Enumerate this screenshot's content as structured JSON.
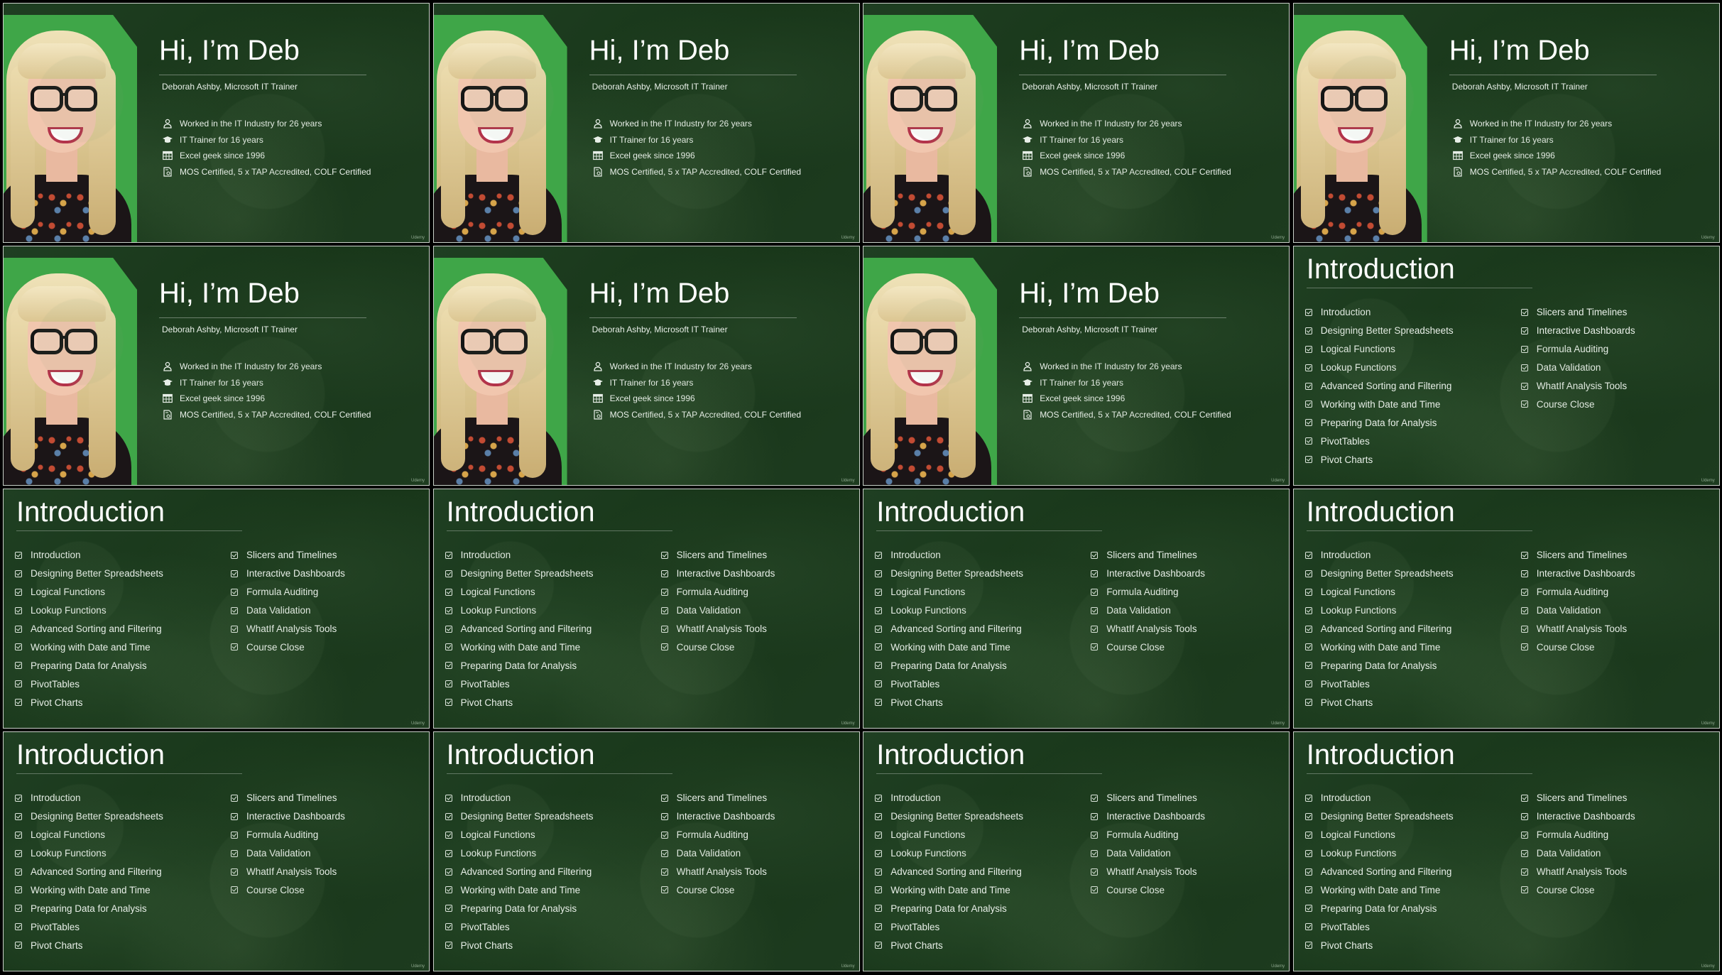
{
  "intro": {
    "title": "Hi, I’m Deb",
    "subtitle": "Deborah Ashby, Microsoft IT Trainer",
    "facts": [
      {
        "icon": "person-icon",
        "text": "Worked in the IT Industry for 26 years"
      },
      {
        "icon": "graduation-cap-icon",
        "text": "IT Trainer for 16 years"
      },
      {
        "icon": "spreadsheet-icon",
        "text": "Excel geek since 1996"
      },
      {
        "icon": "certificate-icon",
        "text": "MOS Certified, 5 x TAP Accredited, COLF Certified"
      }
    ],
    "brand": "Udemy",
    "accent": "#3fa648"
  },
  "agenda": {
    "title": "Introduction",
    "left": [
      "Introduction",
      "Designing Better Spreadsheets",
      "Logical Functions",
      "Lookup Functions",
      "Advanced Sorting and Filtering",
      "Working with Date and Time",
      "Preparing Data for Analysis",
      "PivotTables",
      "Pivot Charts"
    ],
    "right": [
      "Slicers and Timelines",
      "Interactive Dashboards",
      "Formula Auditing",
      "Data Validation",
      "WhatIf Analysis Tools",
      "Course Close"
    ],
    "brand": "Udemy"
  },
  "layout": [
    "intro",
    "intro",
    "intro",
    "intro",
    "intro",
    "intro",
    "intro",
    "agenda",
    "agenda",
    "agenda",
    "agenda",
    "agenda",
    "agenda",
    "agenda",
    "agenda",
    "agenda"
  ]
}
